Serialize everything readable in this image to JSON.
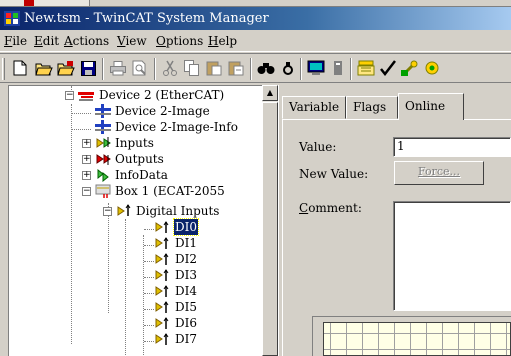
{
  "window": {
    "title": "New.tsm - TwinCAT System Manager",
    "icon": "twincat-app-icon"
  },
  "menu": [
    {
      "label": "File",
      "mnemonic": "F"
    },
    {
      "label": "Edit",
      "mnemonic": "E"
    },
    {
      "label": "Actions",
      "mnemonic": "A"
    },
    {
      "label": "View",
      "mnemonic": "V"
    },
    {
      "label": "Options",
      "mnemonic": "O"
    },
    {
      "label": "Help",
      "mnemonic": "H"
    }
  ],
  "toolbar": {
    "buttons": [
      "new-icon",
      "open-icon",
      "open-from-target-icon",
      "save-icon",
      "print-icon",
      "print-preview-icon",
      "cut-icon",
      "copy-icon",
      "paste-icon",
      "paste-with-links-icon",
      "find-icon",
      "find-next-icon",
      "monitor-icon",
      "generate-mappings-icon",
      "check-configuration-icon",
      "activate-configuration-icon",
      "set-run-mode-icon"
    ]
  },
  "tree": {
    "nodes": [
      {
        "label": "Device 2 (EtherCAT)",
        "icon": "ethercat-device-icon",
        "expander": "minus"
      },
      {
        "label": "Device 2-Image",
        "icon": "image-icon"
      },
      {
        "label": "Device 2-Image-Info",
        "icon": "image-icon"
      },
      {
        "label": "Inputs",
        "icon": "inputs-icon",
        "expander": "plus"
      },
      {
        "label": "Outputs",
        "icon": "outputs-icon",
        "expander": "plus"
      },
      {
        "label": "InfoData",
        "icon": "infodata-icon",
        "expander": "plus"
      },
      {
        "label": "Box 1 (ECAT-2055",
        "icon": "box-icon",
        "expander": "minus"
      },
      {
        "label": "Digital Inputs",
        "icon": "inputs-icon",
        "expander": "minus"
      },
      {
        "label": "DI0",
        "icon": "input-variable-icon",
        "selected": true
      },
      {
        "label": "DI1",
        "icon": "input-variable-icon"
      },
      {
        "label": "DI2",
        "icon": "input-variable-icon"
      },
      {
        "label": "DI3",
        "icon": "input-variable-icon"
      },
      {
        "label": "DI4",
        "icon": "input-variable-icon"
      },
      {
        "label": "DI5",
        "icon": "input-variable-icon"
      },
      {
        "label": "DI6",
        "icon": "input-variable-icon"
      },
      {
        "label": "DI7",
        "icon": "input-variable-icon"
      }
    ]
  },
  "tabs": [
    {
      "label": "Variable",
      "active": false
    },
    {
      "label": "Flags",
      "active": false
    },
    {
      "label": "Online",
      "active": true
    }
  ],
  "online": {
    "value_label": "Value:",
    "value": "1",
    "new_value_label": "New Value:",
    "force_button": "Force...",
    "comment_label": "Comment:",
    "comment_mnemonic": "C"
  },
  "colors": {
    "selection": "#0a246a",
    "titlebar_start": "#0a246a",
    "titlebar_end": "#a6caf0",
    "graph_background": "#ffffe6"
  }
}
